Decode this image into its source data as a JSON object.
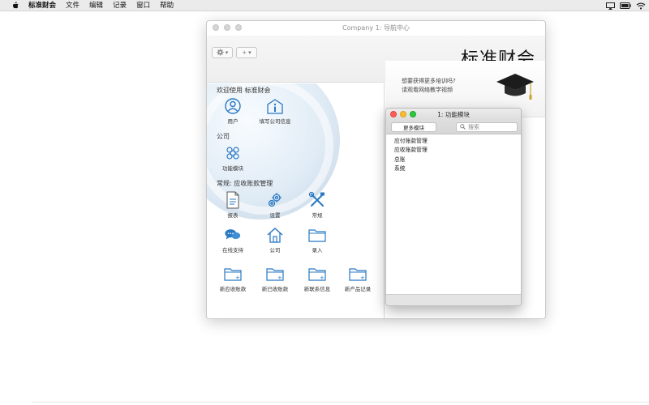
{
  "menubar": {
    "app_name": "标准财会",
    "items": [
      "文件",
      "编辑",
      "记录",
      "窗口",
      "帮助"
    ]
  },
  "main_window": {
    "title": "Company 1: 导航中心",
    "brand": "标准财会",
    "welcome_title": "欢迎使用 标准财会",
    "welcome_items": [
      {
        "label": "用户",
        "icon": "user-icon"
      },
      {
        "label": "填写公司信息",
        "icon": "company-info-icon"
      }
    ],
    "company_title": "公司",
    "company_items": [
      {
        "label": "功能模块",
        "icon": "modules-icon"
      }
    ],
    "general_title": "常规: 应收账款管理",
    "general_items": [
      {
        "label": "报表",
        "icon": "report-icon"
      },
      {
        "label": "设置",
        "icon": "settings-gear-icon"
      },
      {
        "label": "常规",
        "icon": "tools-icon"
      },
      {
        "label": "在线支持",
        "icon": "chat-icon"
      },
      {
        "label": "公司",
        "icon": "house-icon"
      },
      {
        "label": "录入",
        "icon": "folder-icon"
      },
      {
        "label": "新应收账款",
        "icon": "new-folder-icon"
      },
      {
        "label": "新已收账款",
        "icon": "new-folder-icon"
      },
      {
        "label": "新联系信息",
        "icon": "new-folder-icon"
      },
      {
        "label": "新产品记录",
        "icon": "new-folder-icon"
      }
    ],
    "promo": {
      "line1": "想要获得更多培训吗?",
      "line2": "请观看网络教学视频",
      "icon": "graduation-cap-icon"
    }
  },
  "module_window": {
    "title": "1: 功能模块",
    "more_button": "更多模块",
    "search_placeholder": "搜索",
    "modules": [
      "应付账款管理",
      "应收账款管理",
      "总账",
      "系统"
    ]
  },
  "colors": {
    "accent_blue": "#2a78c2",
    "traffic_red": "#fc5f57",
    "traffic_yellow": "#fdbc2e",
    "traffic_green": "#29c840"
  }
}
